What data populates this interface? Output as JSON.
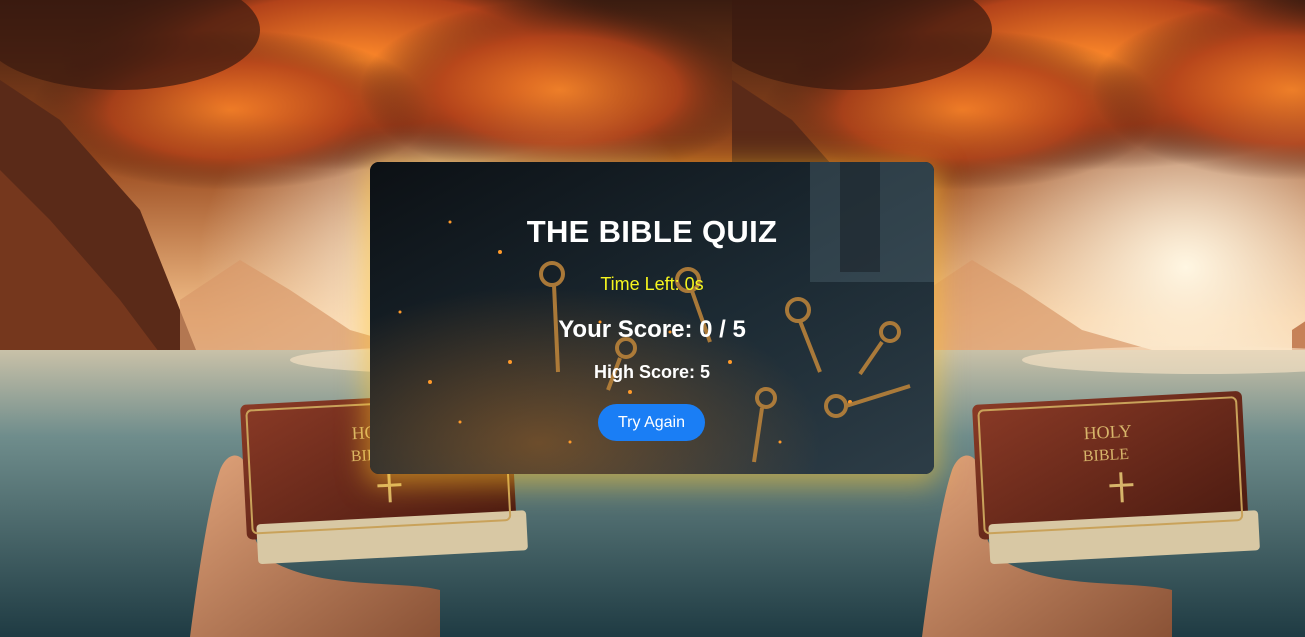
{
  "quiz": {
    "title": "THE BIBLE QUIZ",
    "time_left": "Time Left: 0s",
    "score": "Your Score: 0 / 5",
    "high_score": "High Score: 5",
    "try_again_label": "Try Again"
  },
  "background": {
    "book_cover_text_line1": "HOLY",
    "book_cover_text_line2": "BIBLE"
  },
  "colors": {
    "accent_button": "#1a7ef5",
    "timer_text": "#f5f51e",
    "panel_glow": "#ffc428"
  }
}
